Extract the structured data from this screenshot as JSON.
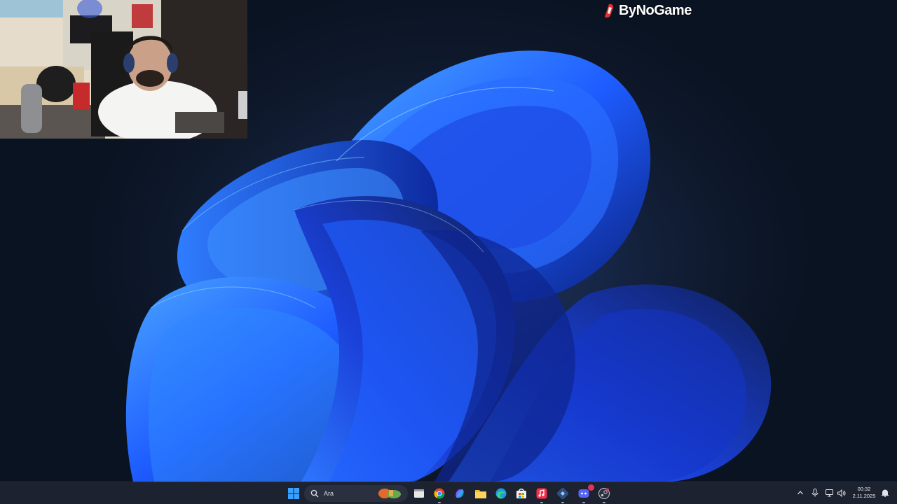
{
  "logo": {
    "text": "ByNoGame"
  },
  "taskbar": {
    "search": {
      "placeholder": "Ara"
    },
    "icons": [
      "start-icon",
      "search-icon",
      "file-manager-icon",
      "chrome-icon",
      "copilot-icon",
      "file-explorer-icon",
      "edge-icon",
      "store-icon",
      "music-icon",
      "app-icon",
      "discord-icon",
      "steam-icon"
    ],
    "discord_badge": "",
    "tray": [
      "chevron-up-icon",
      "microphone-icon",
      "network-icon",
      "volume-icon",
      "notification-icon"
    ],
    "clock": {
      "time": "00:32",
      "date": "2.11.2025"
    }
  },
  "colors": {
    "taskbar_bg": "#1c2230",
    "wallpaper_bloom": "#1f5bff",
    "accent": "#3a8bff"
  }
}
